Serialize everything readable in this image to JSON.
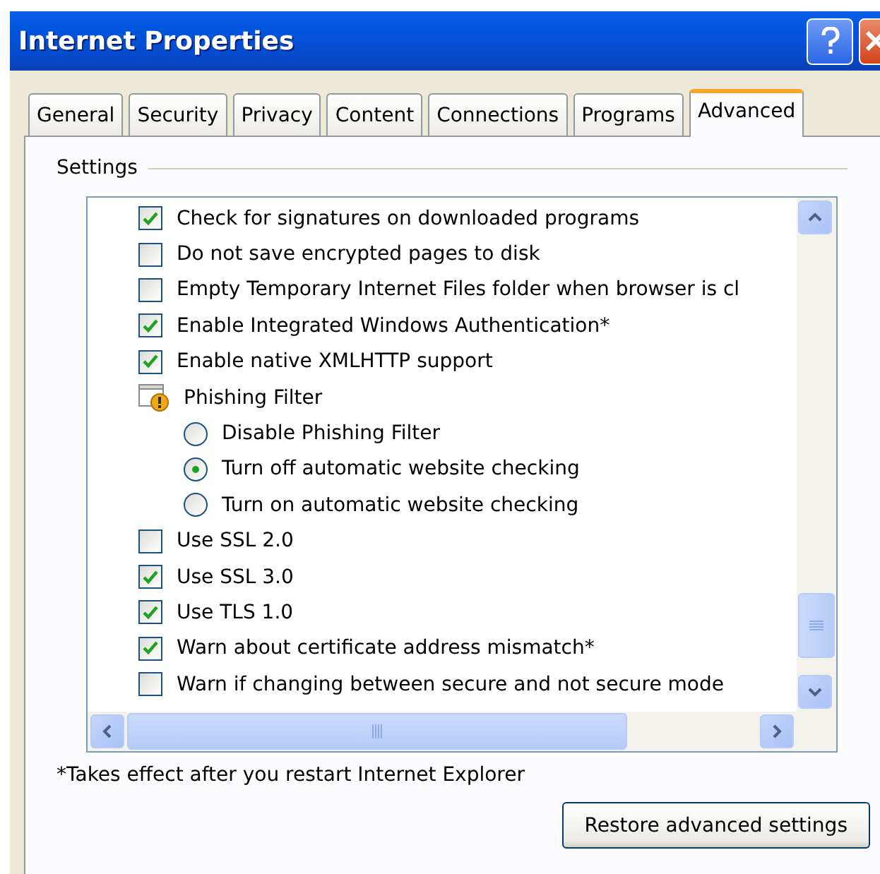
{
  "window": {
    "title": "Internet Properties"
  },
  "tabs": [
    {
      "label": "General",
      "selected": false
    },
    {
      "label": "Security",
      "selected": false
    },
    {
      "label": "Privacy",
      "selected": false
    },
    {
      "label": "Content",
      "selected": false
    },
    {
      "label": "Connections",
      "selected": false
    },
    {
      "label": "Programs",
      "selected": false
    },
    {
      "label": "Advanced",
      "selected": true
    }
  ],
  "group": {
    "label": "Settings"
  },
  "settings": [
    {
      "kind": "checkbox",
      "label": "Check for signatures on downloaded programs",
      "checked": true
    },
    {
      "kind": "checkbox",
      "label": "Do not save encrypted pages to disk",
      "checked": false
    },
    {
      "kind": "checkbox",
      "label": "Empty Temporary Internet Files folder when browser is cl",
      "checked": false
    },
    {
      "kind": "checkbox",
      "label": "Enable Integrated Windows Authentication*",
      "checked": true
    },
    {
      "kind": "checkbox",
      "label": "Enable native XMLHTTP support",
      "checked": true
    },
    {
      "kind": "group",
      "label": "Phishing Filter",
      "children": [
        {
          "kind": "radio",
          "label": "Disable Phishing Filter",
          "selected": false
        },
        {
          "kind": "radio",
          "label": "Turn off automatic website checking",
          "selected": true
        },
        {
          "kind": "radio",
          "label": "Turn on automatic website checking",
          "selected": false
        }
      ]
    },
    {
      "kind": "checkbox",
      "label": "Use SSL 2.0",
      "checked": false
    },
    {
      "kind": "checkbox",
      "label": "Use SSL 3.0",
      "checked": true
    },
    {
      "kind": "checkbox",
      "label": "Use TLS 1.0",
      "checked": true
    },
    {
      "kind": "checkbox",
      "label": "Warn about certificate address mismatch*",
      "checked": true
    },
    {
      "kind": "checkbox",
      "label": "Warn if changing between secure and not secure mode",
      "checked": false
    }
  ],
  "footnote": "*Takes effect after you restart Internet Explorer",
  "buttons": [
    "Restore advanced settings"
  ]
}
